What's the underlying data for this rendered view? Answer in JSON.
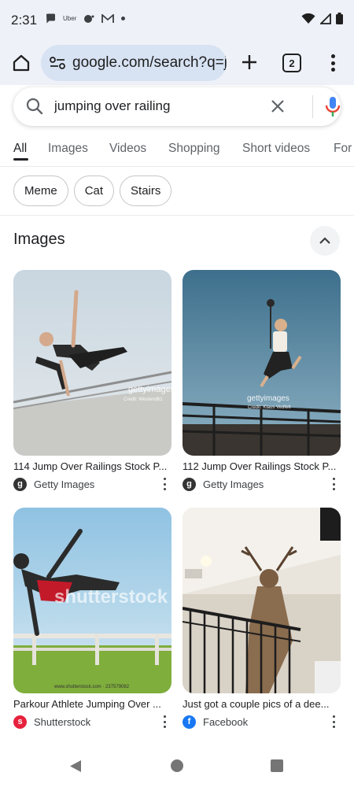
{
  "status_bar": {
    "time": "2:31",
    "notifications": [
      "message-icon",
      "Uber",
      "message-icon",
      "gmail-icon",
      "dot-icon"
    ],
    "uber_label": "Uber"
  },
  "browser": {
    "url": "google.com/search?q=ju",
    "tab_count": "2"
  },
  "search": {
    "query": "jumping over railing"
  },
  "tabs": [
    "All",
    "Images",
    "Videos",
    "Shopping",
    "Short videos",
    "For"
  ],
  "active_tab": "All",
  "chips": [
    "Meme",
    "Cat",
    "Stairs"
  ],
  "images_section": {
    "heading": "Images",
    "results": [
      {
        "title": "114 Jump Over Railings Stock P...",
        "source": "Getty Images",
        "watermark_1": "gettyimages",
        "watermark_2": "Credit: Westend61"
      },
      {
        "title": "112 Jump Over Railings Stock P...",
        "source": "Getty Images",
        "watermark_1": "gettyimages",
        "watermark_2": "Credit: Klaus Vedfelt"
      },
      {
        "title": "Parkour Athlete Jumping Over ...",
        "source": "Shutterstock",
        "watermark_1": "shutterstock",
        "watermark_2": "www.shutterstock.com · 237579082"
      },
      {
        "title": "Just got a couple pics of a dee...",
        "source": "Facebook",
        "watermark_1": "",
        "watermark_2": ""
      }
    ]
  },
  "colors": {
    "chrome_bg": "#eef1f8",
    "url_pill": "#d7e2f3",
    "getty": "#333333",
    "shutterstock": "#e6223d",
    "facebook": "#1877f2",
    "mic_blue": "#4285f4",
    "mic_red": "#ea4335"
  }
}
